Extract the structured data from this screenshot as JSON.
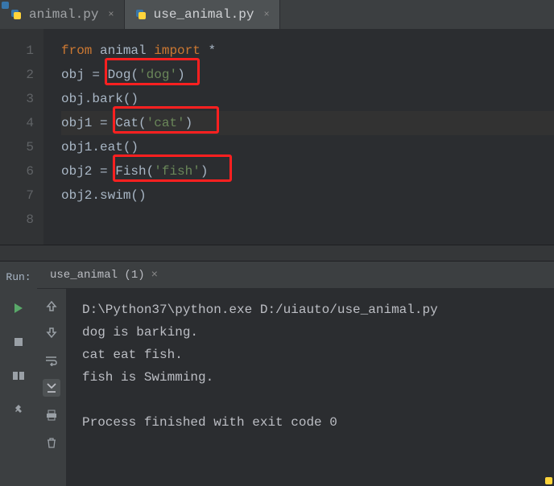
{
  "tabs": [
    {
      "label": "animal.py",
      "active": false
    },
    {
      "label": "use_animal.py",
      "active": true
    }
  ],
  "gutter": [
    "1",
    "2",
    "3",
    "4",
    "5",
    "6",
    "7",
    "8"
  ],
  "code": {
    "l1": {
      "kw1": "from",
      "mod": "animal",
      "kw2": "import",
      "star": "*"
    },
    "l2": {
      "lhs": "obj",
      "eq": " = ",
      "cls": "Dog",
      "lp": "(",
      "arg": "'dog'",
      "rp": ")"
    },
    "l3": {
      "txt": "obj.bark()"
    },
    "l4": {
      "lhs": "obj1",
      "eq": " = ",
      "cls": "Cat",
      "lp": "(",
      "arg": "'cat'",
      "rp": ")"
    },
    "l5": {
      "txt": "obj1.eat()"
    },
    "l6": {
      "lhs": "obj2",
      "eq": " = ",
      "cls": "Fish",
      "lp": "(",
      "arg": "'fish'",
      "rp": ")"
    },
    "l7": {
      "txt": "obj2.swim()"
    }
  },
  "run": {
    "panel_label": "Run:",
    "config_label": "use_animal (1)",
    "output": [
      "D:\\Python37\\python.exe D:/uiauto/use_animal.py",
      "dog is barking.",
      "cat eat fish.",
      "fish is Swimming.",
      "",
      "Process finished with exit code 0"
    ]
  }
}
